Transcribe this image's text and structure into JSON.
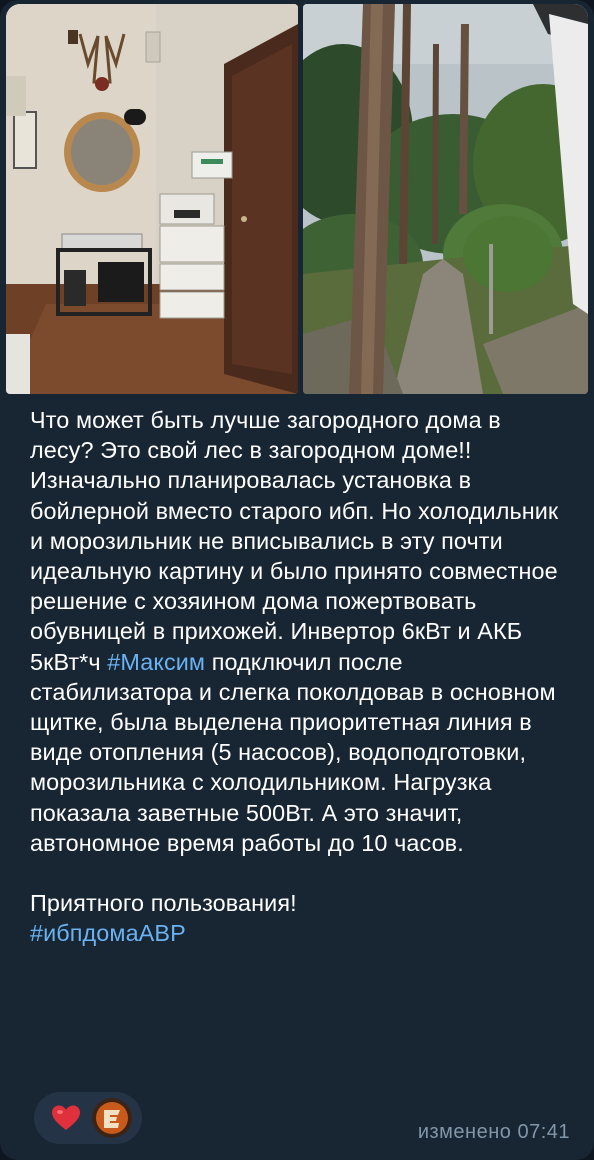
{
  "message": {
    "paragraph_1": "Что может быть лучше загородного дома в лесу? Это свой лес в загородном доме!!",
    "paragraph_2_before": "Изначально планировалась установка в бойлерной вместо старого ибп. Но холодильник и морозильник не вписывались в эту почти идеальную картину и было принято совместное решение с хозяином дома пожертвовать обувницей в прихожей. Инвертор 6кВт и АКБ 5кВт*ч ",
    "paragraph_2_hashtag": "#Максим",
    "paragraph_2_after": " подключил после стабилизатора и слегка поколдовав в основном щитке, была выделена приоритетная линия в виде отопления (5 насосов), водоподготовки, морозильника с холодильником. Нагрузка показала заветные 500Вт. А это значит, автономное время работы до 10 часов.",
    "closing": "Приятного пользования!",
    "closing_hashtag": "#ибпдомаАВР"
  },
  "photos": [
    {
      "subject": "hallway-inverter-installation"
    },
    {
      "subject": "forest-path-garden"
    }
  ],
  "reactions": [
    {
      "icon": "heart-icon",
      "color": "#e0303b"
    },
    {
      "icon": "reactor-avatar"
    }
  ],
  "meta": {
    "status": "изменено 07:41"
  },
  "colors": {
    "bubble": "#182533",
    "text": "#ffffff",
    "link": "#6ab2f2",
    "meta": "#8296a9"
  }
}
